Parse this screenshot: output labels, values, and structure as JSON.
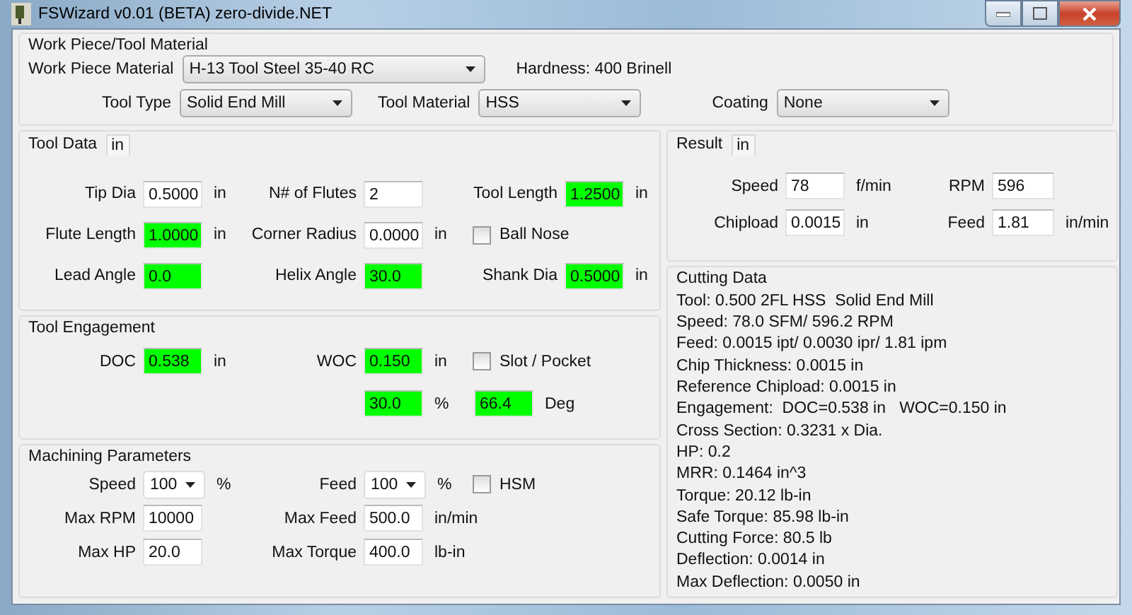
{
  "window": {
    "title": "FSWizard v0.01 (BETA) zero-divide.NET"
  },
  "work_piece": {
    "title": "Work Piece/Tool Material",
    "material": {
      "label": "Work Piece Material",
      "value": "H-13 Tool Steel 35-40 RC"
    },
    "hardness": "Hardness: 400 Brinell",
    "tool_type": {
      "label": "Tool Type",
      "value": "Solid End Mill"
    },
    "tool_material": {
      "label": "Tool Material",
      "value": "HSS"
    },
    "coating": {
      "label": "Coating",
      "value": "None"
    }
  },
  "tool_data": {
    "title": "Tool Data",
    "unit_tab": "in",
    "rows": [
      [
        {
          "kind": "field",
          "label": "Tip Dia",
          "value": "0.5000",
          "unit": "in",
          "highlighted": false
        },
        {
          "kind": "field",
          "label": "N# of Flutes",
          "value": "2",
          "highlighted": false
        },
        {
          "kind": "field",
          "label": "Tool Length",
          "value": "1.2500",
          "unit": "in",
          "highlighted": true
        }
      ],
      [
        {
          "kind": "field",
          "label": "Flute Length",
          "value": "1.0000",
          "unit": "in",
          "highlighted": true
        },
        {
          "kind": "field",
          "label": "Corner Radius",
          "value": "0.0000",
          "unit": "in",
          "highlighted": false
        },
        {
          "kind": "checkbox",
          "label": "Ball Nose",
          "checked": false
        }
      ],
      [
        {
          "kind": "field",
          "label": "Lead Angle",
          "value": "0.0",
          "highlighted": true
        },
        {
          "kind": "field",
          "label": "Helix Angle",
          "value": "30.0",
          "highlighted": true
        },
        {
          "kind": "field",
          "label": "Shank Dia",
          "value": "0.5000",
          "unit": "in",
          "highlighted": true
        }
      ]
    ]
  },
  "tool_engagement": {
    "title": "Tool Engagement",
    "rows": [
      [
        {
          "kind": "field",
          "label": "DOC",
          "value": "0.538",
          "unit": "in",
          "highlighted": true
        },
        {
          "kind": "field",
          "label": "WOC",
          "value": "0.150",
          "unit": "in",
          "highlighted": true
        },
        {
          "kind": "checkbox",
          "label": "Slot / Pocket",
          "checked": false
        }
      ]
    ],
    "angles": [
      {
        "value": "30.0",
        "unit": "%",
        "highlighted": true
      },
      {
        "value": "66.4",
        "unit": "Deg",
        "highlighted": true
      }
    ]
  },
  "machining": {
    "title": "Machining Parameters",
    "rows": [
      [
        {
          "kind": "select",
          "label": "Speed",
          "value": "100",
          "unit": "%"
        },
        {
          "kind": "select",
          "label": "Feed",
          "value": "100",
          "unit": "%"
        },
        {
          "kind": "checkbox",
          "label": "HSM",
          "checked": false
        }
      ],
      [
        {
          "kind": "field",
          "label": "Max RPM",
          "value": "10000",
          "highlighted": false
        },
        {
          "kind": "field",
          "label": "Max Feed",
          "value": "500.0",
          "unit": "in/min",
          "highlighted": false
        }
      ],
      [
        {
          "kind": "field",
          "label": "Max HP",
          "value": "20.0",
          "highlighted": false
        },
        {
          "kind": "field",
          "label": "Max Torque",
          "value": "400.0",
          "unit": "lb-in",
          "highlighted": false
        }
      ]
    ]
  },
  "result": {
    "title": "Result",
    "unit_tab": "in",
    "rows": [
      [
        {
          "kind": "field",
          "label": "Speed",
          "value": "78",
          "unit": "f/min",
          "highlighted": false
        },
        {
          "kind": "field",
          "label": "RPM",
          "value": "596",
          "highlighted": false
        }
      ],
      [
        {
          "kind": "field",
          "label": "Chipload",
          "value": "0.0015",
          "unit": "in",
          "highlighted": false
        },
        {
          "kind": "field",
          "label": "Feed",
          "value": "1.81",
          "unit": "in/min",
          "highlighted": false
        }
      ]
    ]
  },
  "cutting_data": {
    "title": "Cutting Data",
    "lines": [
      "Tool: 0.500 2FL HSS  Solid End Mill",
      "Speed: 78.0 SFM/ 596.2 RPM",
      "Feed: 0.0015 ipt/ 0.0030 ipr/ 1.81 ipm",
      "Chip Thickness: 0.0015 in",
      "Reference Chipload: 0.0015 in",
      "Engagement:  DOC=0.538 in   WOC=0.150 in",
      "Cross Section: 0.3231 x Dia.",
      "HP: 0.2",
      "MRR: 0.1464 in^3",
      "Torque: 20.12 lb-in",
      "Safe Torque: 85.98 lb-in",
      "Cutting Force: 80.5 lb",
      "Deflection: 0.0014 in",
      "Max Deflection: 0.0050 in"
    ]
  }
}
